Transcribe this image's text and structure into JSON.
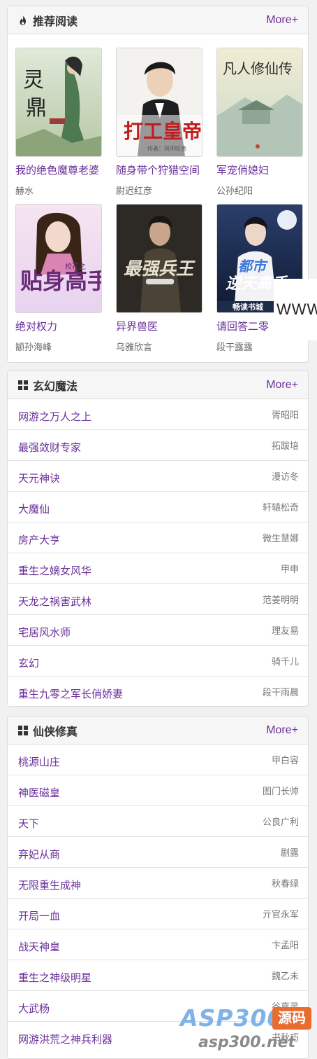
{
  "featured": {
    "title": "推荐阅读",
    "more": "More+",
    "icon": "fire-icon",
    "books": [
      {
        "title": "我的绝色魔尊老婆",
        "author": "赫水",
        "cover_text": "灵鼎"
      },
      {
        "title": "随身带个狩猎空间",
        "author": "尉迟红彦",
        "cover_text": "打工皇帝"
      },
      {
        "title": "军宠俏媳妇",
        "author": "公孙纪阳",
        "cover_text": "凡人修仙传"
      },
      {
        "title": "绝对权力",
        "author": "颛孙海峰",
        "cover_text": "贴身高手"
      },
      {
        "title": "异界兽医",
        "author": "乌雅欣言",
        "cover_text": "最强兵王"
      },
      {
        "title": "请回答二零",
        "author": "段干露露",
        "cover_text": "都市逆天高手"
      }
    ],
    "overlay_text": "WWW"
  },
  "sections": [
    {
      "title": "玄幻魔法",
      "more": "More+",
      "icon": "grid-icon",
      "items": [
        {
          "title": "网游之万人之上",
          "author": "胥昭阳"
        },
        {
          "title": "最强敛财专家",
          "author": "拓跋培"
        },
        {
          "title": "天元神诀",
          "author": "漫访冬"
        },
        {
          "title": "大魔仙",
          "author": "轩辕松奇"
        },
        {
          "title": "房产大亨",
          "author": "微生慧娜"
        },
        {
          "title": "重生之嫡女风华",
          "author": "甲申"
        },
        {
          "title": "天龙之祸害武林",
          "author": "范姜明明"
        },
        {
          "title": "宅居风水师",
          "author": "理友易"
        },
        {
          "title": "玄幻",
          "author": "骑千儿"
        },
        {
          "title": "重生九零之军长俏娇妻",
          "author": "段干雨晨"
        }
      ]
    },
    {
      "title": "仙侠修真",
      "more": "More+",
      "icon": "grid-icon",
      "items": [
        {
          "title": "桃源山庄",
          "author": "甲白容"
        },
        {
          "title": "神医磁皇",
          "author": "图门长帅"
        },
        {
          "title": "天下",
          "author": "公良广利"
        },
        {
          "title": "弃妃从商",
          "author": "剧露"
        },
        {
          "title": "无限重生成神",
          "author": "秋春绿"
        },
        {
          "title": "开局一血",
          "author": "亓官永军"
        },
        {
          "title": "战天神皇",
          "author": "卞孟阳"
        },
        {
          "title": "重生之神级明星",
          "author": "魏乙未"
        },
        {
          "title": "大武杨",
          "author": "谷嘉灵"
        },
        {
          "title": "网游洪荒之神兵利器",
          "author": "书秋巧"
        }
      ]
    }
  ],
  "watermark": {
    "logo": "ASP300",
    "badge": "源码",
    "url": "asp300.net"
  },
  "colors": {
    "accent": "#6a2e9a",
    "author": "#666666",
    "header_bg": "#f6f6f6"
  }
}
